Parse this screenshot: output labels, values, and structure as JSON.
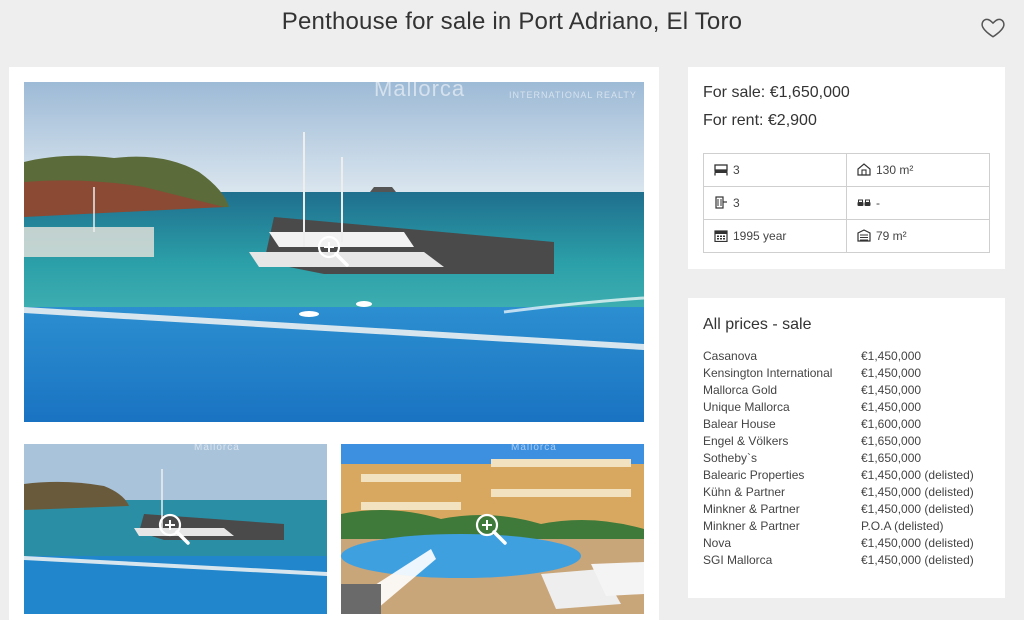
{
  "page": {
    "title": "Penthouse for sale in Port Adriano, El Toro",
    "favorite_icon": "heart-outline-icon"
  },
  "gallery": {
    "watermark_main": "Mallorca",
    "watermark_sub": "INTERNATIONAL REALTY",
    "watermark_small_1": "Mallorca",
    "watermark_small_2": "Mallorca",
    "zoom_icon": "zoom-in-icon"
  },
  "pricing": {
    "sale": "For sale: €1,650,000",
    "rent": "For rent: €2,900",
    "features": {
      "bedrooms": "3",
      "built_area": "130 m²",
      "bathrooms": "3",
      "parking": "-",
      "year": "1995 year",
      "plot_area": "79 m²"
    }
  },
  "all_prices": {
    "title": "All prices - sale",
    "rows": [
      {
        "agency": "Casanova",
        "price": "€1,450,000"
      },
      {
        "agency": "Kensington International",
        "price": "€1,450,000"
      },
      {
        "agency": "Mallorca Gold",
        "price": "€1,450,000"
      },
      {
        "agency": "Unique Mallorca",
        "price": "€1,450,000"
      },
      {
        "agency": "Balear House",
        "price": "€1,600,000"
      },
      {
        "agency": "Engel & Völkers",
        "price": "€1,650,000"
      },
      {
        "agency": "Sotheby`s",
        "price": "€1,650,000"
      },
      {
        "agency": "Balearic Properties",
        "price": "€1,450,000 (delisted)"
      },
      {
        "agency": "Kühn & Partner",
        "price": "€1,450,000 (delisted)"
      },
      {
        "agency": "Minkner & Partner",
        "price": "€1,450,000 (delisted)"
      },
      {
        "agency": "Minkner & Partner",
        "price": "P.O.A (delisted)"
      },
      {
        "agency": "Nova",
        "price": "€1,450,000 (delisted)"
      },
      {
        "agency": "SGI Mallorca",
        "price": "€1,450,000 (delisted)"
      }
    ]
  }
}
